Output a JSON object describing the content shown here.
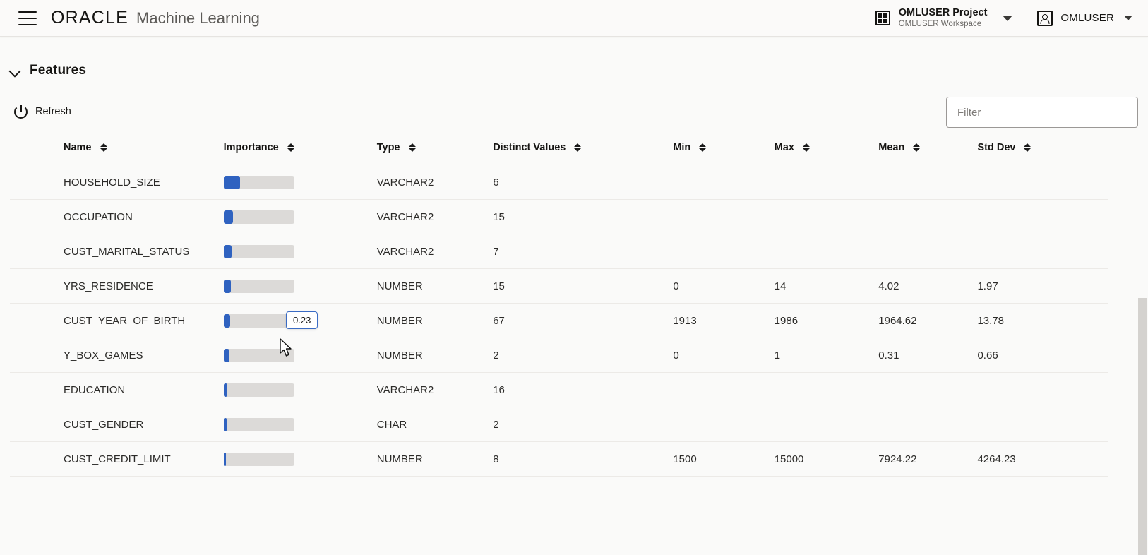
{
  "header": {
    "menu_icon": "hamburger-menu-icon",
    "brand_primary": "ORACLE",
    "brand_secondary": "Machine Learning",
    "project": {
      "icon": "grid-icon",
      "name": "OMLUSER Project",
      "workspace": "OMLUSER Workspace",
      "caret": "chevron-down-icon"
    },
    "user": {
      "icon": "user-avatar-icon",
      "name": "OMLUSER",
      "caret": "chevron-down-icon"
    }
  },
  "section": {
    "collapse_icon": "chevron-down-icon",
    "title": "Features"
  },
  "toolbar": {
    "refresh_icon": "power-refresh-icon",
    "refresh_label": "Refresh",
    "filter_placeholder": "Filter",
    "filter_value": ""
  },
  "tooltip": {
    "value": "0.23"
  },
  "colors": {
    "bar_fill": "#2f62c0",
    "bar_track": "#dcdad8",
    "page_bg": "#fafaf9",
    "tooltip_border": "#3a6bc4"
  },
  "table": {
    "columns": [
      {
        "label": "Name",
        "sort_icon": "sort-arrows-icon"
      },
      {
        "label": "Importance",
        "sort_icon": "sort-arrows-icon"
      },
      {
        "label": "Type",
        "sort_icon": "sort-arrows-icon"
      },
      {
        "label": "Distinct Values",
        "sort_icon": "sort-arrows-icon"
      },
      {
        "label": "Min",
        "sort_icon": "sort-arrows-icon"
      },
      {
        "label": "Max",
        "sort_icon": "sort-arrows-icon"
      },
      {
        "label": "Mean",
        "sort_icon": "sort-arrows-icon"
      },
      {
        "label": "Std Dev",
        "sort_icon": "sort-arrows-icon"
      }
    ],
    "rows": [
      {
        "name": "HOUSEHOLD_SIZE",
        "importance": 0.23,
        "importance_pct": 23,
        "type": "VARCHAR2",
        "distinct": "6",
        "min": "",
        "max": "",
        "mean": "",
        "std": ""
      },
      {
        "name": "OCCUPATION",
        "importance": 0.13,
        "importance_pct": 13,
        "type": "VARCHAR2",
        "distinct": "15",
        "min": "",
        "max": "",
        "mean": "",
        "std": ""
      },
      {
        "name": "CUST_MARITAL_STATUS",
        "importance": 0.11,
        "importance_pct": 11,
        "type": "VARCHAR2",
        "distinct": "7",
        "min": "",
        "max": "",
        "mean": "",
        "std": ""
      },
      {
        "name": "YRS_RESIDENCE",
        "importance": 0.1,
        "importance_pct": 10,
        "type": "NUMBER",
        "distinct": "15",
        "min": "0",
        "max": "14",
        "mean": "4.02",
        "std": "1.97"
      },
      {
        "name": "CUST_YEAR_OF_BIRTH",
        "importance": 0.09,
        "importance_pct": 9,
        "type": "NUMBER",
        "distinct": "67",
        "min": "1913",
        "max": "1986",
        "mean": "1964.62",
        "std": "13.78"
      },
      {
        "name": "Y_BOX_GAMES",
        "importance": 0.08,
        "importance_pct": 8,
        "type": "NUMBER",
        "distinct": "2",
        "min": "0",
        "max": "1",
        "mean": "0.31",
        "std": "0.66"
      },
      {
        "name": "EDUCATION",
        "importance": 0.05,
        "importance_pct": 5,
        "type": "VARCHAR2",
        "distinct": "16",
        "min": "",
        "max": "",
        "mean": "",
        "std": ""
      },
      {
        "name": "CUST_GENDER",
        "importance": 0.04,
        "importance_pct": 4,
        "type": "CHAR",
        "distinct": "2",
        "min": "",
        "max": "",
        "mean": "",
        "std": ""
      },
      {
        "name": "CUST_CREDIT_LIMIT",
        "importance": 0.03,
        "importance_pct": 3,
        "type": "NUMBER",
        "distinct": "8",
        "min": "1500",
        "max": "15000",
        "mean": "7924.22",
        "std": "4264.23"
      }
    ]
  },
  "scrollbar": {
    "name": "vertical-scrollbar"
  }
}
